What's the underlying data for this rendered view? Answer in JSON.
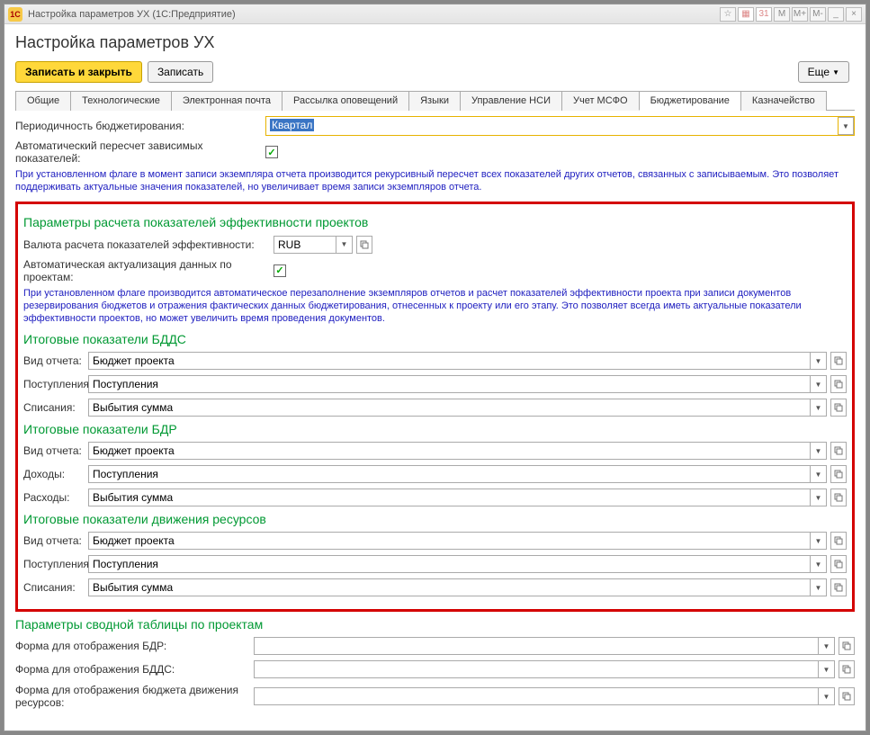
{
  "window": {
    "logo_text": "1C",
    "title": "Настройка параметров УХ  (1С:Предприятие)",
    "mem_btns": [
      "M",
      "M+",
      "M-"
    ],
    "minimize": "_",
    "close": "×"
  },
  "page_title": "Настройка параметров УХ",
  "toolbar": {
    "write_close": "Записать и закрыть",
    "write": "Записать",
    "more": "Еще"
  },
  "tabs": [
    "Общие",
    "Технологические",
    "Электронная почта",
    "Рассылка оповещений",
    "Языки",
    "Управление НСИ",
    "Учет МСФО",
    "Бюджетирование",
    "Казначейство"
  ],
  "active_tab": 7,
  "periodicity": {
    "label": "Периодичность бюджетирования:",
    "value": "Квартал"
  },
  "auto_recalc": {
    "label": "Автоматический пересчет зависимых показателей:",
    "checked": "✓"
  },
  "help1": "При установленном флаге в момент записи экземпляра отчета производится рекурсивный пересчет всех показателей других отчетов, связанных с записываемым. Это позволяет поддерживать актуальные значения показателей, но увеличивает время записи экземпляров отчета.",
  "sec_eff": {
    "title": "Параметры расчета показателей эффективности проектов",
    "currency_label": "Валюта расчета показателей эффективности:",
    "currency_value": "RUB",
    "auto_label": "Автоматическая актуализация данных по проектам:",
    "auto_checked": "✓",
    "help": "При установленном флаге производится автоматическое перезаполнение экземпляров отчетов и расчет показателей эффективности проекта при записи документов резервирования бюджетов и отражения фактических данных бюджетирования, отнесенных к проекту или его этапу. Это позволяет всегда иметь актуальные показатели эффективности проектов, но может увеличить время проведения документов."
  },
  "bdds": {
    "title": "Итоговые показатели БДДС",
    "report_label": "Вид отчета:",
    "report_value": "Бюджет проекта",
    "in_label": "Поступления:",
    "in_value": "Поступления",
    "out_label": "Списания:",
    "out_value": "Выбытия сумма"
  },
  "bdr": {
    "title": "Итоговые показатели БДР",
    "report_label": "Вид отчета:",
    "report_value": "Бюджет проекта",
    "in_label": "Доходы:",
    "in_value": "Поступления",
    "out_label": "Расходы:",
    "out_value": "Выбытия сумма"
  },
  "resmove": {
    "title": "Итоговые показатели движения ресурсов",
    "report_label": "Вид отчета:",
    "report_value": "Бюджет проекта",
    "in_label": "Поступления:",
    "in_value": "Поступления",
    "out_label": "Списания:",
    "out_value": "Выбытия сумма"
  },
  "summary": {
    "title": "Параметры сводной таблицы по проектам",
    "bdr_label": "Форма для отображения БДР:",
    "bdds_label": "Форма для отображения БДДС:",
    "res_label": "Форма для отображения бюджета движения ресурсов:",
    "bdr_value": "",
    "bdds_value": "",
    "res_value": ""
  }
}
